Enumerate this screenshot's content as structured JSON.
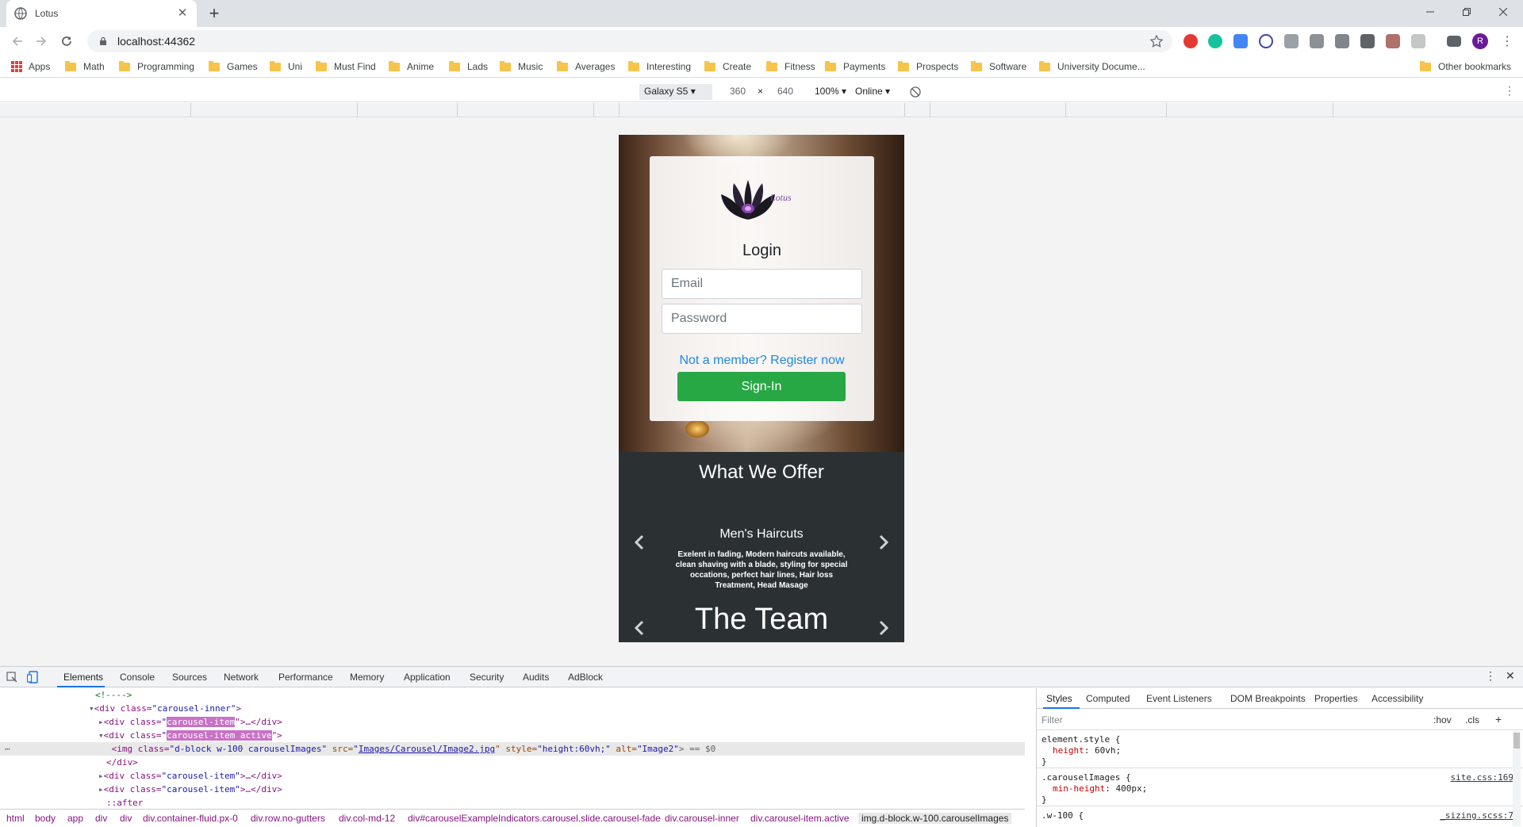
{
  "browser": {
    "tab_title": "Lotus",
    "new_tab_icon": "plus-icon",
    "url": "localhost:44362",
    "profile_initial": "R"
  },
  "bookmarks": {
    "apps": "Apps",
    "items": [
      "Math",
      "Programming",
      "Games",
      "Uni",
      "Must Find",
      "Anime",
      "Lads",
      "Music",
      "Averages",
      "Interesting",
      "Create",
      "Fitness",
      "Payments",
      "Prospects",
      "Software",
      "University Docume..."
    ],
    "other": "Other bookmarks"
  },
  "device_toolbar": {
    "device": "Galaxy S5",
    "width": "360",
    "times": "×",
    "height": "640",
    "zoom": "100%",
    "network": "Online"
  },
  "page": {
    "logo_text": "Lotus",
    "login_title": "Login",
    "email_placeholder": "Email",
    "password_placeholder": "Password",
    "register_link": "Not a member? Register now",
    "signin_button": "Sign-In",
    "offer_title": "What We Offer",
    "service_name": "Men's Haircuts",
    "service_desc": "Exelent in fading, Modern haircuts available, clean shaving with a blade, styling for special occations, perfect hair lines, Hair loss Treatment, Head Masage",
    "team_title": "The Team"
  },
  "devtools": {
    "tabs": [
      "Elements",
      "Console",
      "Sources",
      "Network",
      "Performance",
      "Memory",
      "Application",
      "Security",
      "Audits",
      "AdBlock"
    ],
    "active_tab": "Elements",
    "dom": {
      "l0": "<!---->",
      "l1_tag": "<div class=",
      "l1_val": "\"carousel-inner\"",
      "l1_end": ">",
      "l2_tag": "<div class=",
      "l2_hl": "carousel-item",
      "l2_end": "\">…</div>",
      "l3_tag": "<div class=",
      "l3_hl": "carousel-item active",
      "l3_end": "\">",
      "l4_a": "<img class=",
      "l4_b": "\"d-block w-100 carouselImages\"",
      "l4_c": " src=",
      "l4_d": "\"",
      "l4_link": "Images/Carousel/Image2.jpg",
      "l4_e": "\" style=",
      "l4_f": "\"height:60vh;\"",
      "l4_g": " alt=",
      "l4_h": "\"Image2\"",
      "l4_i": "> == $0",
      "l5": "</div>",
      "l6_tag": "<div class=",
      "l6_val": "\"carousel-item\"",
      "l6_end": ">…</div>",
      "l7_tag": "<div class=",
      "l7_val": "\"carousel-item\"",
      "l7_end": ">…</div>",
      "l8": "::after"
    },
    "breadcrumbs": [
      "html",
      "body",
      "app",
      "div",
      "div",
      "div.container-fluid.px-0",
      "div.row.no-gutters",
      "div.col-md-12",
      "div#carouselExampleIndicators.carousel.slide.carousel-fade",
      "div.carousel-inner",
      "div.carousel-item.active",
      "img.d-block.w-100.carouselImages"
    ],
    "styles_tabs": [
      "Styles",
      "Computed",
      "Event Listeners",
      "DOM Breakpoints",
      "Properties",
      "Accessibility"
    ],
    "filter_placeholder": "Filter",
    "hov": ":hov",
    "cls": ".cls",
    "plus": "+",
    "rules": {
      "r1_sel": "element.style {",
      "r1_prop": "height",
      "r1_val": ": 60vh;",
      "r1_end": "}",
      "r2_sel": ".carouselImages {",
      "r2_src": "site.css:169",
      "r2_prop": "min-height",
      "r2_val": ": 400px;",
      "r2_end": "}",
      "r3_sel": ".w-100 {",
      "r3_src": "_sizing.scss:7"
    }
  },
  "colors": {
    "accent": "#1a73e8",
    "signin": "#28a745",
    "link": "#1e88e5",
    "page_dark": "#2b3132"
  }
}
